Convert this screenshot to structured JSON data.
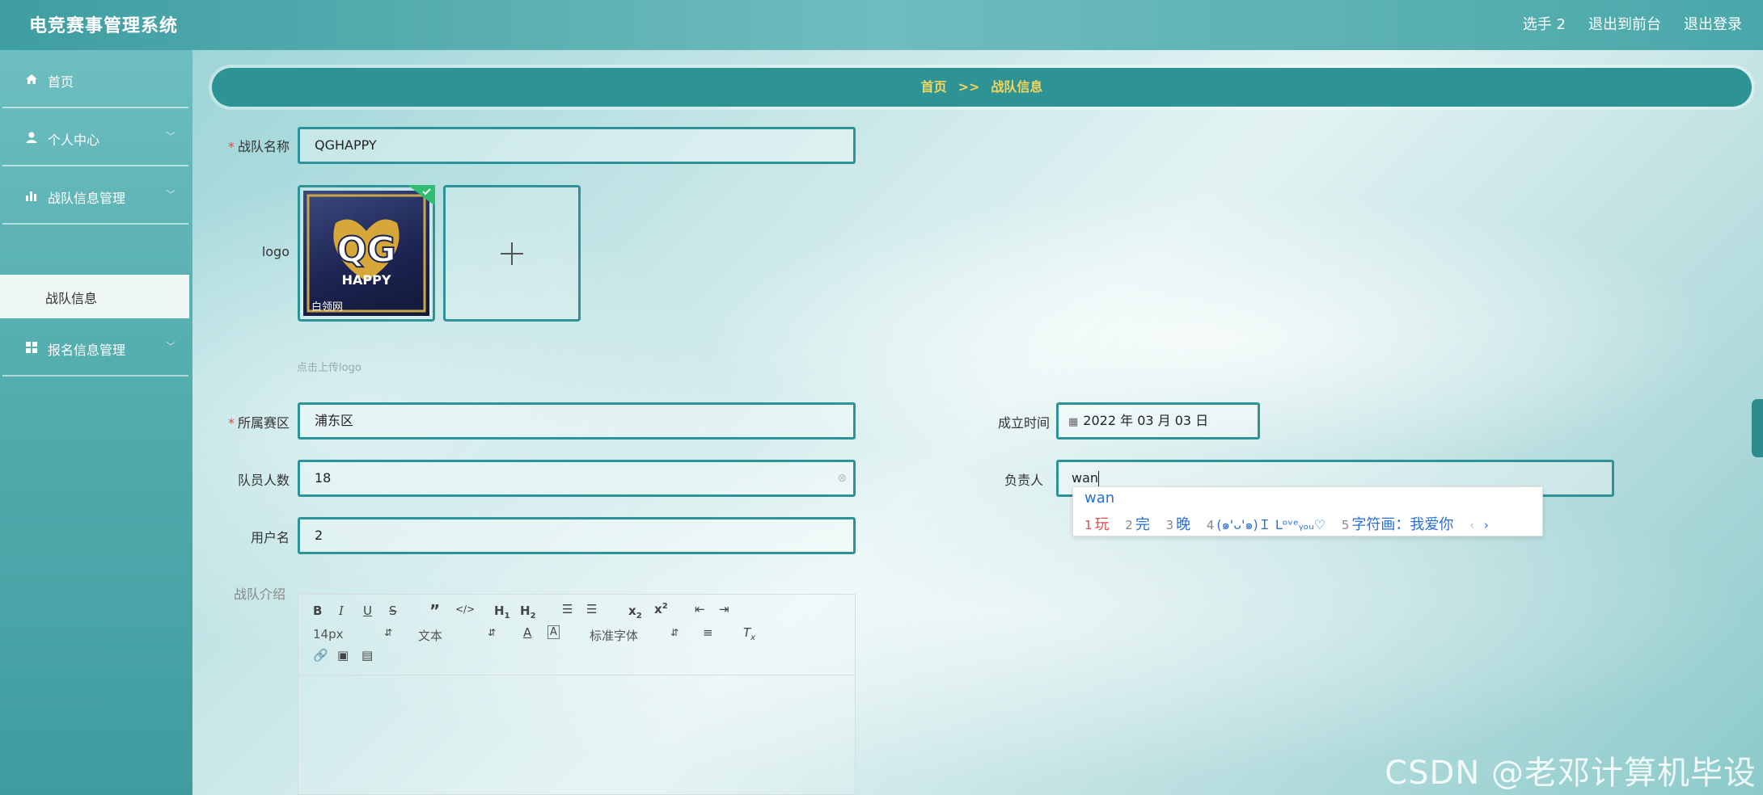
{
  "app": {
    "title": "电竞赛事管理系统"
  },
  "header": {
    "user": "选手 2",
    "front_link": "退出到前台",
    "logout_link": "退出登录"
  },
  "sidebar": {
    "items": [
      {
        "label": "首页",
        "icon": "home-icon"
      },
      {
        "label": "个人中心",
        "icon": "user-icon"
      },
      {
        "label": "战队信息管理",
        "icon": "bar-chart-icon"
      },
      {
        "label": "报名信息管理",
        "icon": "grid-icon"
      }
    ],
    "sub_item": "战队信息"
  },
  "breadcrumb": {
    "home": "首页",
    "separator": ">>",
    "current": "战队信息"
  },
  "form": {
    "team_name": {
      "label": "战队名称",
      "value": "QGHAPPY",
      "required": true
    },
    "logo": {
      "label": "logo",
      "hint": "点击上传logo",
      "image_text_main": "QG",
      "image_text_sub": "HAPPY",
      "image_watermark": "白领网"
    },
    "region": {
      "label": "所属赛区",
      "value": "浦东区",
      "required": true
    },
    "found_date": {
      "label": "成立时间",
      "value": "2022 年 03 月 03 日"
    },
    "members": {
      "label": "队员人数",
      "value": "18"
    },
    "leader": {
      "label": "负责人",
      "value": "wan"
    },
    "username": {
      "label": "用户名",
      "value": "2"
    },
    "intro": {
      "label": "战队介绍"
    }
  },
  "editor": {
    "font_size": "14px",
    "paragraph": "文本",
    "font_family": "标准字体"
  },
  "ime": {
    "composition": "wan",
    "candidates": [
      {
        "n": "1",
        "text": "玩"
      },
      {
        "n": "2",
        "text": "完"
      },
      {
        "n": "3",
        "text": "晚"
      },
      {
        "n": "4",
        "text": "(๑'ᴗ'๑)Ｉ Lᵒᵛᵉᵧₒᵤ♡"
      },
      {
        "n": "5",
        "text": "字符画：我爱你"
      }
    ]
  },
  "watermark": "CSDN @老邓计算机毕设",
  "colors": {
    "accent": "#2e9397",
    "breadcrumb_text": "#f5d65a",
    "required": "#e04b4b"
  }
}
